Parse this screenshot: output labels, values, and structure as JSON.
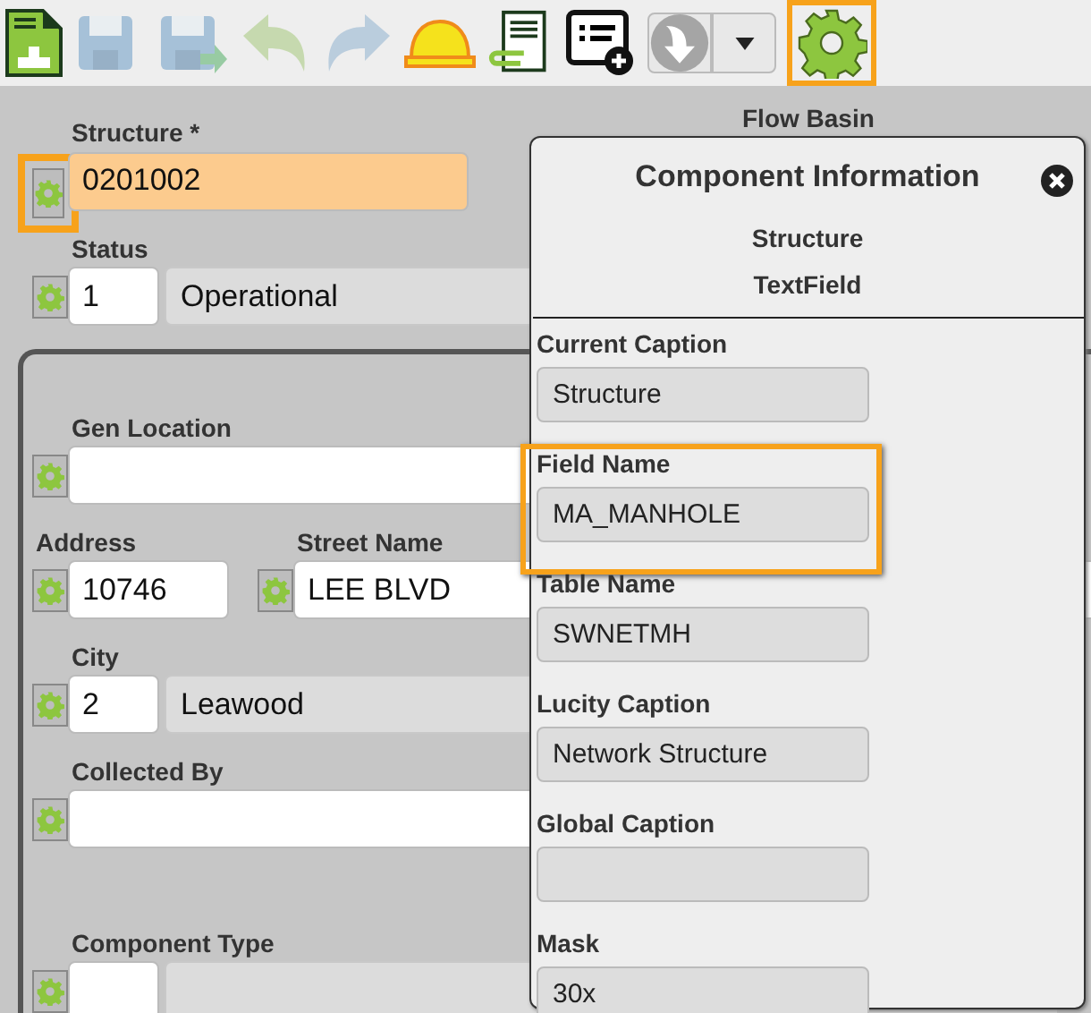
{
  "toolbar": [
    {
      "kind": "new-document",
      "disabled": false,
      "highlighted": false
    },
    {
      "kind": "save",
      "disabled": true,
      "highlighted": false
    },
    {
      "kind": "save-as",
      "disabled": true,
      "highlighted": false
    },
    {
      "kind": "undo",
      "disabled": true,
      "highlighted": false
    },
    {
      "kind": "redo",
      "disabled": true,
      "highlighted": false
    },
    {
      "kind": "hard-hat",
      "disabled": false,
      "highlighted": false
    },
    {
      "kind": "attachment",
      "disabled": false,
      "highlighted": false
    },
    {
      "kind": "list-add",
      "disabled": false,
      "highlighted": false
    },
    {
      "kind": "download",
      "disabled": false,
      "highlighted": false
    },
    {
      "kind": "caret",
      "disabled": false,
      "highlighted": false
    },
    {
      "kind": "settings",
      "disabled": false,
      "highlighted": true
    }
  ],
  "form": {
    "header": [
      {
        "label": "Structure *",
        "kind": "text",
        "value": "0201002",
        "required": true,
        "highlighted": true
      },
      {
        "label": "Status",
        "kind": "code",
        "code": "1",
        "description": "Operational",
        "required": false,
        "highlighted": false
      }
    ],
    "side_label": "Flow Basin",
    "group": [
      [
        {
          "label": "Gen Location",
          "kind": "text",
          "required": false,
          "highlighted": false
        }
      ],
      [
        {
          "label": "Address",
          "kind": "short",
          "value": "10746",
          "required": false,
          "highlighted": false
        },
        {
          "label": "Street Name",
          "kind": "text",
          "value": "LEE BLVD",
          "required": false,
          "highlighted": false
        }
      ],
      [
        {
          "label": "City",
          "kind": "code",
          "code": "2",
          "description": "Leawood",
          "required": false,
          "highlighted": false
        }
      ],
      [
        {
          "label": "Collected By",
          "kind": "text",
          "required": false,
          "highlighted": false
        }
      ],
      [
        {
          "label": "Component Type",
          "kind": "code",
          "required": false,
          "highlighted": false
        }
      ]
    ]
  },
  "popup": {
    "title": "Component Information",
    "subtitle": [
      "Structure",
      "TextField"
    ],
    "properties": [
      {
        "label": "Current Caption",
        "value": "Structure",
        "highlighted": false
      },
      {
        "label": "Field Name",
        "value": "MA_MANHOLE",
        "highlighted": true
      },
      {
        "label": "Table Name",
        "value": "SWNETMH",
        "highlighted": false
      },
      {
        "label": "Lucity Caption",
        "value": "Network Structure",
        "highlighted": false
      },
      {
        "label": "Global Caption",
        "highlighted": false
      },
      {
        "label": "Mask",
        "value": "30x",
        "highlighted": false
      }
    ]
  }
}
